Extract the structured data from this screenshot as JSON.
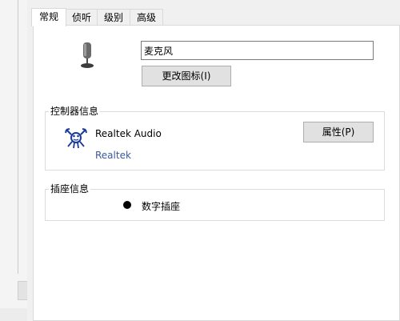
{
  "tabs": [
    "常规",
    "侦听",
    "级别",
    "高级"
  ],
  "device": {
    "name_value": "麦克风",
    "change_icon_label": "更改图标(I)"
  },
  "controller": {
    "title": "控制器信息",
    "name": "Realtek Audio",
    "vendor": "Realtek",
    "properties_label": "属性(P)"
  },
  "jack": {
    "title": "插座信息",
    "label": "数字插座"
  },
  "colors": {
    "panel_bg": "#ffffff",
    "dialog_bg": "#f0f0f0",
    "vendor_text": "#3a5a9a",
    "button_bg": "#e1e1e1"
  },
  "icons": {
    "device": "microphone-icon",
    "controller": "realtek-crab-icon",
    "jack": "jack-dot-icon"
  }
}
